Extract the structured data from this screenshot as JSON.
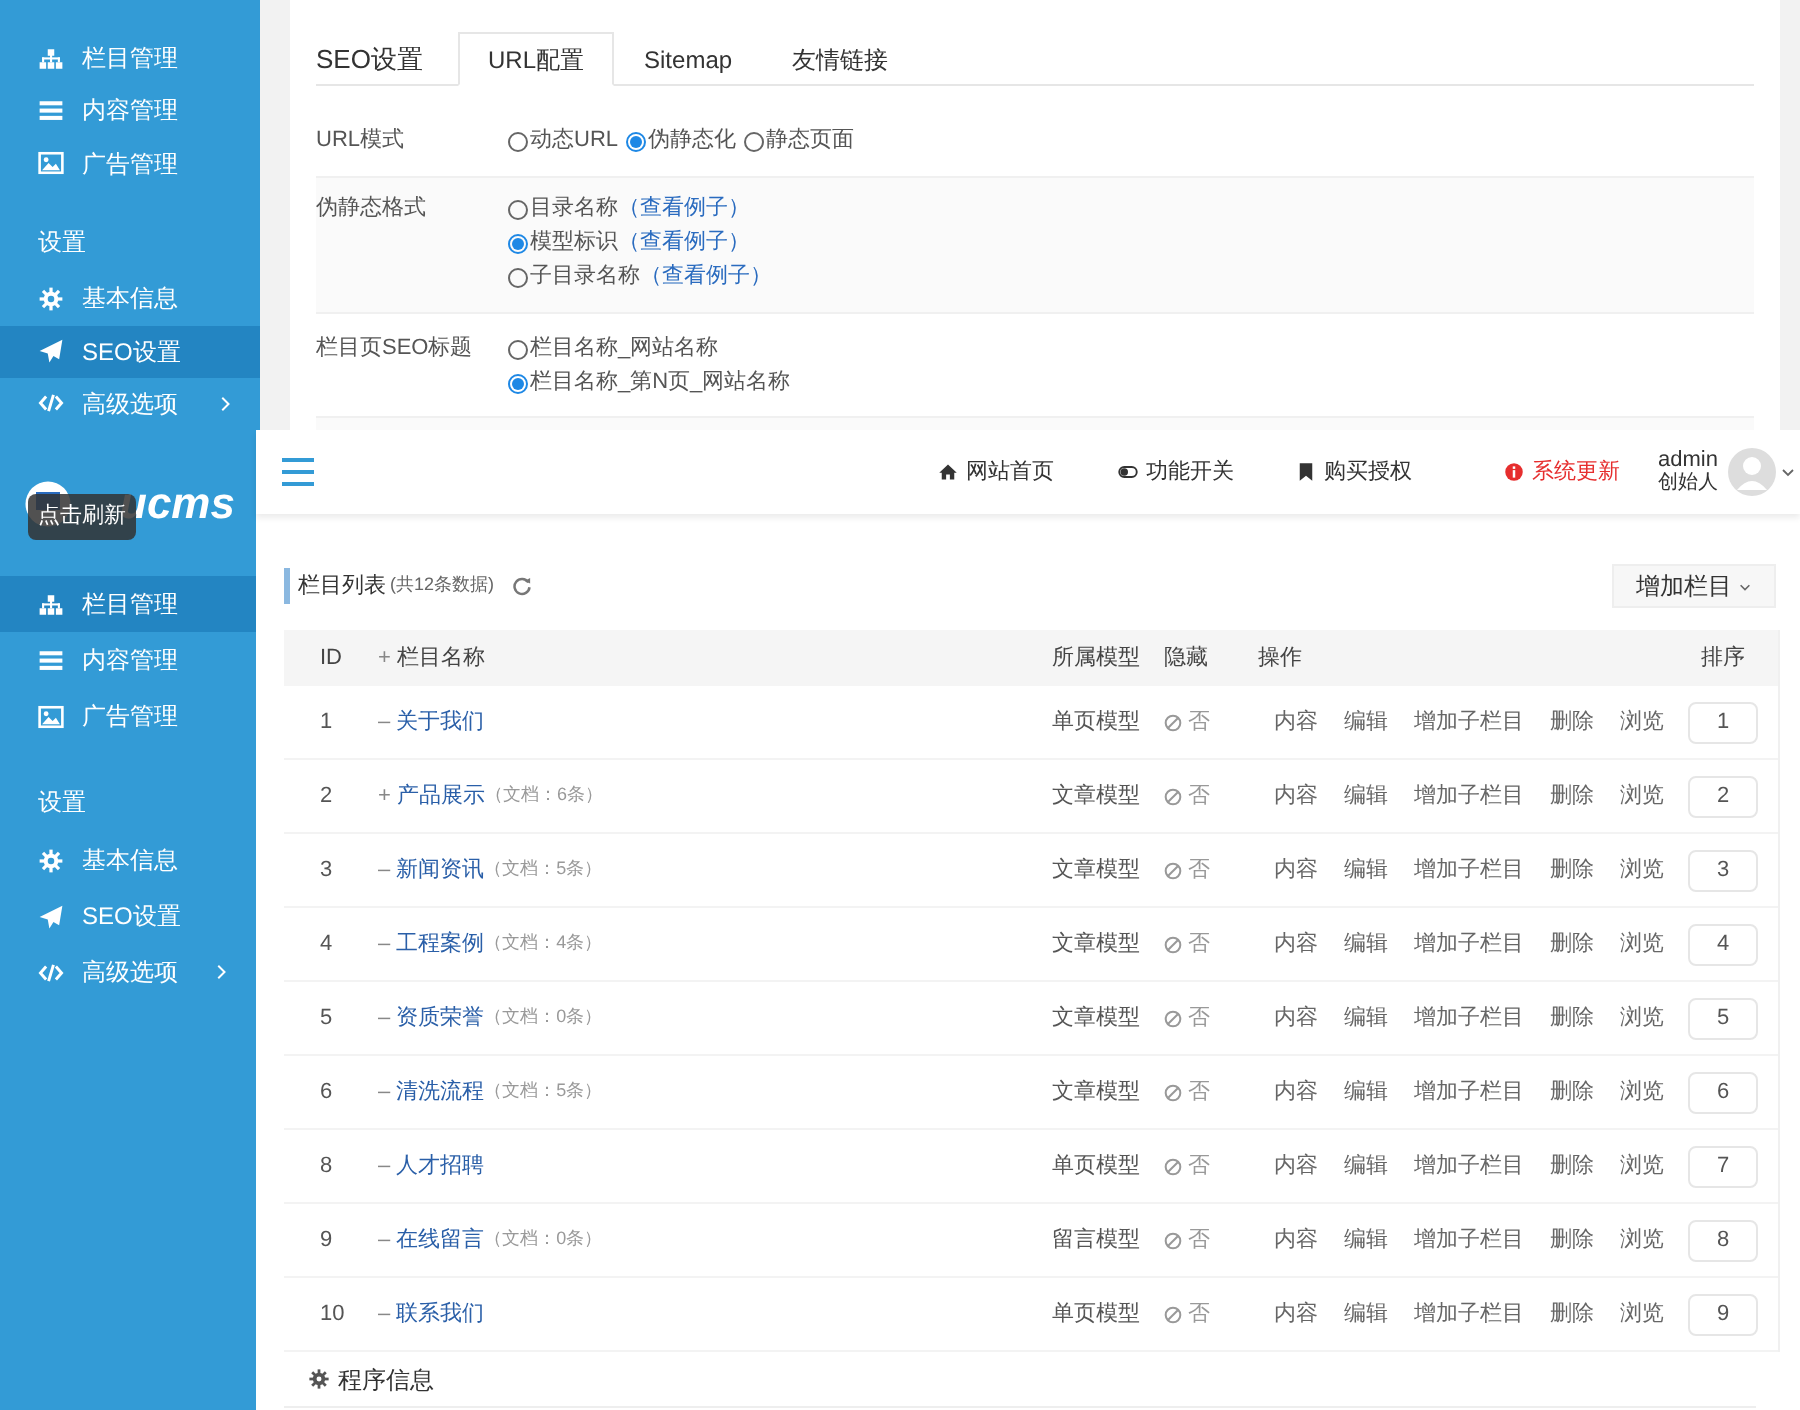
{
  "top_screen": {
    "sidebar": {
      "menu": [
        {
          "label": "栏目管理",
          "selected": false,
          "submenu": false
        },
        {
          "label": "内容管理",
          "selected": false,
          "submenu": false
        },
        {
          "label": "广告管理",
          "selected": false,
          "submenu": false
        }
      ],
      "section_title": "设置",
      "settings": [
        {
          "label": "基本信息",
          "selected": false,
          "submenu": false
        },
        {
          "label": "SEO设置",
          "selected": true,
          "submenu": false
        },
        {
          "label": "高级选项",
          "selected": false,
          "submenu": true
        }
      ]
    },
    "panel": {
      "title": "SEO设置",
      "tabs": [
        {
          "label": "URL配置",
          "selected": true
        },
        {
          "label": "Sitemap",
          "selected": false
        },
        {
          "label": "友情链接",
          "selected": false
        }
      ],
      "fields": [
        {
          "label": "URL模式",
          "inline": true,
          "options": [
            {
              "label": "动态URL",
              "selected": false
            },
            {
              "label": "伪静态化",
              "selected": true
            },
            {
              "label": "静态页面",
              "selected": false
            }
          ]
        },
        {
          "label": "伪静态格式",
          "inline": false,
          "options": [
            {
              "label": "目录名称",
              "link": "（查看例子）",
              "selected": false
            },
            {
              "label": "模型标识",
              "link": "（查看例子）",
              "selected": true
            },
            {
              "label": "子目录名称",
              "link": "（查看例子）",
              "selected": false
            }
          ]
        },
        {
          "label": "栏目页SEO标题",
          "inline": false,
          "options": [
            {
              "label": "栏目名称_网站名称",
              "selected": false
            },
            {
              "label": "栏目名称_第N页_网站名称",
              "selected": true
            }
          ]
        }
      ]
    }
  },
  "bottom_screen": {
    "sidebar": {
      "logo": "ucms",
      "tooltip": "点击刷新",
      "menu": [
        {
          "label": "栏目管理",
          "selected": true,
          "submenu": false
        },
        {
          "label": "内容管理",
          "selected": false,
          "submenu": false
        },
        {
          "label": "广告管理",
          "selected": false,
          "submenu": false
        }
      ],
      "section_title": "设置",
      "settings": [
        {
          "label": "基本信息",
          "selected": false,
          "submenu": false
        },
        {
          "label": "SEO设置",
          "selected": false,
          "submenu": false
        },
        {
          "label": "高级选项",
          "selected": false,
          "submenu": true
        }
      ]
    },
    "header": {
      "links": [
        {
          "label": "网站首页",
          "kind": "home"
        },
        {
          "label": "功能开关",
          "kind": "toggle"
        },
        {
          "label": "购买授权",
          "kind": "bookmark"
        },
        {
          "label": "系统更新",
          "kind": "alert"
        }
      ],
      "user": {
        "name": "admin",
        "role": "创始人"
      }
    },
    "list": {
      "title": "栏目列表",
      "count": "(共12条数据)",
      "add_button": "增加栏目",
      "columns": [
        "ID",
        "栏目名称",
        "所属模型",
        "隐藏",
        "操作",
        "排序"
      ],
      "header_expander": "+",
      "rows": [
        {
          "id": "1",
          "expander": "–",
          "name": "关于我们",
          "docs": "",
          "model": "单页模型",
          "hidden": "否",
          "actions": [
            "内容",
            "编辑",
            "增加子栏目",
            "删除",
            "浏览"
          ],
          "sort": "1"
        },
        {
          "id": "2",
          "expander": "+",
          "name": "产品展示",
          "docs": "（文档：6条）",
          "model": "文章模型",
          "hidden": "否",
          "actions": [
            "内容",
            "编辑",
            "增加子栏目",
            "删除",
            "浏览"
          ],
          "sort": "2"
        },
        {
          "id": "3",
          "expander": "–",
          "name": "新闻资讯",
          "docs": "（文档：5条）",
          "model": "文章模型",
          "hidden": "否",
          "actions": [
            "内容",
            "编辑",
            "增加子栏目",
            "删除",
            "浏览"
          ],
          "sort": "3"
        },
        {
          "id": "4",
          "expander": "–",
          "name": "工程案例",
          "docs": "（文档：4条）",
          "model": "文章模型",
          "hidden": "否",
          "actions": [
            "内容",
            "编辑",
            "增加子栏目",
            "删除",
            "浏览"
          ],
          "sort": "4"
        },
        {
          "id": "5",
          "expander": "–",
          "name": "资质荣誉",
          "docs": "（文档：0条）",
          "model": "文章模型",
          "hidden": "否",
          "actions": [
            "内容",
            "编辑",
            "增加子栏目",
            "删除",
            "浏览"
          ],
          "sort": "5"
        },
        {
          "id": "6",
          "expander": "–",
          "name": "清洗流程",
          "docs": "（文档：5条）",
          "model": "文章模型",
          "hidden": "否",
          "actions": [
            "内容",
            "编辑",
            "增加子栏目",
            "删除",
            "浏览"
          ],
          "sort": "6"
        },
        {
          "id": "8",
          "expander": "–",
          "name": "人才招聘",
          "docs": "",
          "model": "单页模型",
          "hidden": "否",
          "actions": [
            "内容",
            "编辑",
            "增加子栏目",
            "删除",
            "浏览"
          ],
          "sort": "7"
        },
        {
          "id": "9",
          "expander": "–",
          "name": "在线留言",
          "docs": "（文档：0条）",
          "model": "留言模型",
          "hidden": "否",
          "actions": [
            "内容",
            "编辑",
            "增加子栏目",
            "删除",
            "浏览"
          ],
          "sort": "8"
        },
        {
          "id": "10",
          "expander": "–",
          "name": "联系我们",
          "docs": "",
          "model": "单页模型",
          "hidden": "否",
          "actions": [
            "内容",
            "编辑",
            "增加子栏目",
            "删除",
            "浏览"
          ],
          "sort": "9"
        }
      ]
    },
    "program_info": {
      "title": "程序信息"
    }
  }
}
